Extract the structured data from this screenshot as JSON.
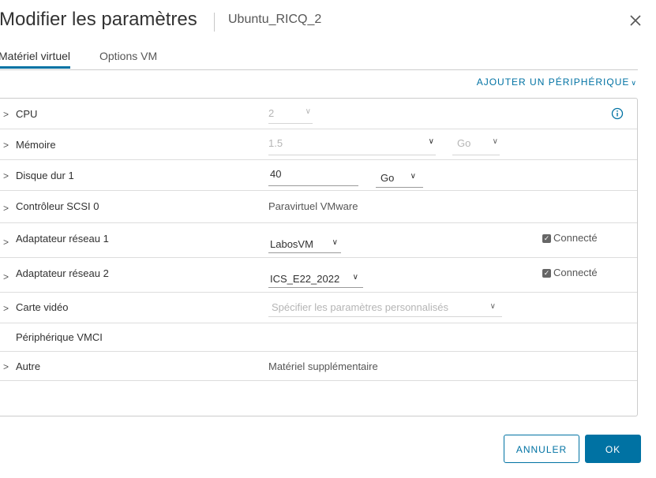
{
  "dialog": {
    "title": "Modifier les paramètres",
    "vm_name": "Ubuntu_RICQ_2"
  },
  "tabs": [
    {
      "label": "Matériel virtuel",
      "active": true
    },
    {
      "label": "Options VM",
      "active": false
    }
  ],
  "add_device": "AJOUTER UN PÉRIPHÉRIQUE",
  "rows": {
    "cpu": {
      "label": "CPU",
      "value": "2"
    },
    "memory": {
      "label": "Mémoire",
      "value": "1.5",
      "unit": "Go"
    },
    "disk": {
      "label": "Disque dur 1",
      "value": "40",
      "unit": "Go"
    },
    "scsi": {
      "label": "Contrôleur SCSI 0",
      "value": "Paravirtuel VMware"
    },
    "net1": {
      "label": "Adaptateur réseau 1",
      "value": "LabosVM",
      "connected_label": "Connecté",
      "connected": true
    },
    "net2": {
      "label": "Adaptateur réseau 2",
      "value": "ICS_E22_2022",
      "connected_label": "Connecté",
      "connected": true
    },
    "video": {
      "label": "Carte vidéo",
      "value": "Spécifier les paramètres personnalisés"
    },
    "vmci": {
      "label": "Périphérique VMCI"
    },
    "other": {
      "label": "Autre",
      "value": "Matériel supplémentaire"
    }
  },
  "buttons": {
    "cancel": "ANNULER",
    "ok": "OK"
  },
  "colors": {
    "accent": "#0072a3",
    "border": "#cccccc"
  },
  "icons": [
    "close-icon",
    "chevron-down-icon",
    "chevron-right-icon",
    "info-icon",
    "checkbox-icon"
  ]
}
